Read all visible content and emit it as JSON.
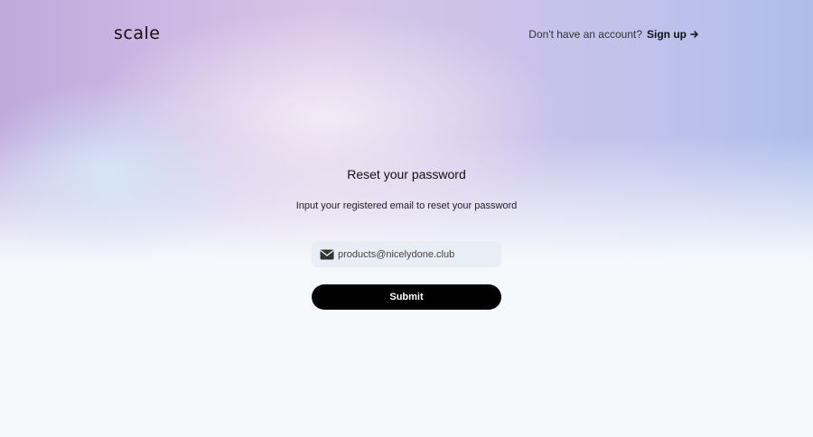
{
  "brand": {
    "logo_text": "scale"
  },
  "header": {
    "prompt_text": "Don't have an account?",
    "signup_label": "Sign up"
  },
  "form": {
    "title": "Reset your password",
    "subtitle": "Input your registered email to reset your password",
    "email_value": "products@nicelydone.club",
    "submit_label": "Submit"
  },
  "icons": {
    "email": "mail-icon",
    "signup_arrow": "arrow-right-icon"
  },
  "colors": {
    "button_bg": "#000000",
    "input_bg": "#e9edf5",
    "gradient_purple": "#cbb8e4",
    "gradient_blue": "#afbdea",
    "page_bg": "#f6f9fc"
  }
}
